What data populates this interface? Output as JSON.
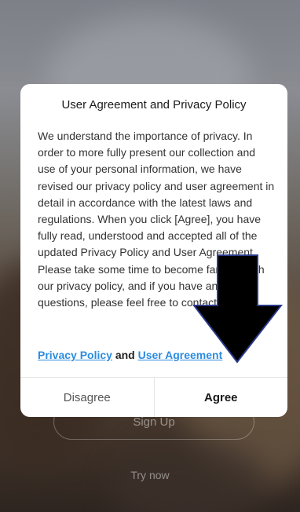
{
  "dialog": {
    "title": "User Agreement and Privacy Policy",
    "body": "We understand the importance of privacy. In order to more fully present our collection and use of your personal information, we have revised our privacy policy and user agreement in detail in accordance with the latest laws and regulations. When you click [Agree], you have fully read, understood and accepted all of the updated Privacy Policy and User Agreement. Please take some time to become familiar with our privacy policy, and if you have any questions, please feel free to contact us.",
    "privacy_link": "Privacy Policy",
    "and_text": " and ",
    "user_agreement_link": "User Agreement",
    "disagree_label": "Disagree",
    "agree_label": "Agree"
  },
  "background": {
    "signup_label": "Sign Up",
    "try_now_label": "Try now"
  },
  "colors": {
    "link": "#2b8ce0",
    "dialog_bg": "#ffffff",
    "arrow": "#000000"
  },
  "icons": {
    "arrow": "down-arrow-icon"
  }
}
